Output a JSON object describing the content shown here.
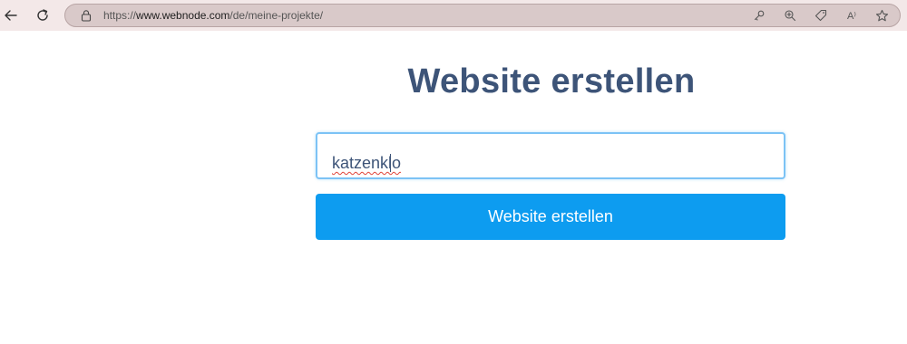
{
  "browser": {
    "url_scheme": "https://",
    "url_host": "www.webnode.com",
    "url_path": "/de/meine-projekte/",
    "icons": [
      "back-arrow-icon",
      "reload-icon",
      "lock-icon",
      "key-icon",
      "zoom-in-icon",
      "tag-icon",
      "read-aloud-icon",
      "star-icon"
    ],
    "read_aloud_label": "A⁾"
  },
  "main": {
    "title": "Website erstellen",
    "input_value": "katzenklo",
    "button_label": "Website erstellen"
  },
  "colors": {
    "title": "#3d5478",
    "button": "#0d9cf0",
    "input_border": "#7cc3f5",
    "browser_bar": "#f3e8e8"
  }
}
